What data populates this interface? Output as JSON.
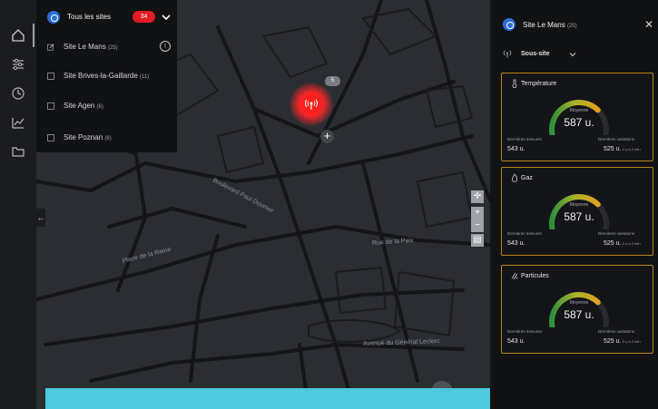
{
  "colors": {
    "accent_red": "#ff1f1f",
    "badge_red": "#e01c24",
    "card_border": "#b8861b",
    "gauge_gradient": [
      "#2f8f3a",
      "#a9b22a",
      "#e0a21f"
    ],
    "banner": "#4ec9dd",
    "site_avatar": "#2c6fd6"
  },
  "rail": {
    "icons": [
      "home-icon",
      "settings-sliders-icon",
      "clock-icon",
      "chart-icon",
      "folder-icon"
    ]
  },
  "site_selector": {
    "title": "Tous les sites",
    "badge": "34",
    "chevron_icon": "chevron-down-icon",
    "items": [
      {
        "label": "Site Le Mans",
        "count": "(25)",
        "selected": true,
        "icon": "edit-checkbox-icon"
      },
      {
        "label": "Site Brives-la-Gaillarde",
        "count": "(11)",
        "selected": false
      },
      {
        "label": "Site Agen",
        "count": "(6)",
        "selected": false
      },
      {
        "label": "Site Poznan",
        "count": "(6)",
        "selected": false
      }
    ],
    "info_icon": "info-icon"
  },
  "map": {
    "marker_count": "5",
    "marker_icon": "antenna-icon",
    "add_icon": "plus-icon",
    "controls": [
      "compass-icon",
      "zoom-in-icon",
      "zoom-out-icon",
      "layers-icon"
    ],
    "collapse_icon": "arrow-left-icon"
  },
  "right_panel": {
    "title": "Site Le Mans",
    "title_count": "(25)",
    "close_icon": "close-icon",
    "subsite_icon": "antenna-icon",
    "subsite_label": "Sous-site",
    "subsite_chevron": "chevron-down-icon",
    "cards": [
      {
        "title": "Température",
        "icon": "thermometer-icon",
        "gauge_caption": "Moyenne",
        "gauge_value": "587 u.",
        "gauge_fraction": 0.62,
        "stat_left_caption": "Dernières mesures",
        "stat_left_value": "543 u.",
        "stat_right_caption": "Dernières variations",
        "stat_right_value": "525 u.",
        "stat_right_unit": "il y a 2 min"
      },
      {
        "title": "Gaz",
        "icon": "flame-icon",
        "gauge_caption": "Moyenne",
        "gauge_value": "587 u.",
        "gauge_fraction": 0.62,
        "stat_left_caption": "Dernières mesures",
        "stat_left_value": "543 u.",
        "stat_right_caption": "Dernières variations",
        "stat_right_value": "525 u.",
        "stat_right_unit": "il y a 2 min"
      },
      {
        "title": "Particules",
        "icon": "particles-icon",
        "gauge_caption": "Moyenne",
        "gauge_value": "587 u.",
        "gauge_fraction": 0.62,
        "stat_left_caption": "Dernières mesures",
        "stat_left_value": "543 u.",
        "stat_right_caption": "Dernières variations",
        "stat_right_value": "525 u.",
        "stat_right_unit": "il y a 2 min"
      }
    ]
  }
}
